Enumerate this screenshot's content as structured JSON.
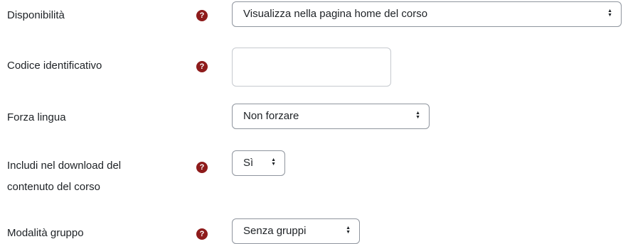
{
  "form": {
    "availability": {
      "label": "Disponibilità",
      "help_icon": "question-circle-icon",
      "value": "Visualizza nella pagina home del corso",
      "caret": "◆"
    },
    "idnumber": {
      "label": "Codice identificativo",
      "help_icon": "question-circle-icon",
      "value": "",
      "placeholder": ""
    },
    "forcelanguage": {
      "label": "Forza lingua",
      "value": "Non forzare",
      "caret": "◆"
    },
    "downloadcontent": {
      "label_line1": "Includi nel download del",
      "label_line2": "contenuto del corso",
      "help_icon": "question-circle-icon",
      "value": "Sì",
      "caret": "◆"
    },
    "groupmode": {
      "label": "Modalità gruppo",
      "help_icon": "question-circle-icon",
      "value": "Senza gruppi",
      "caret": "◆"
    }
  },
  "help_glyph": "?",
  "colors": {
    "help_icon_bg": "#8e1b1b",
    "border": "#8f959e",
    "text": "#1d2125"
  }
}
